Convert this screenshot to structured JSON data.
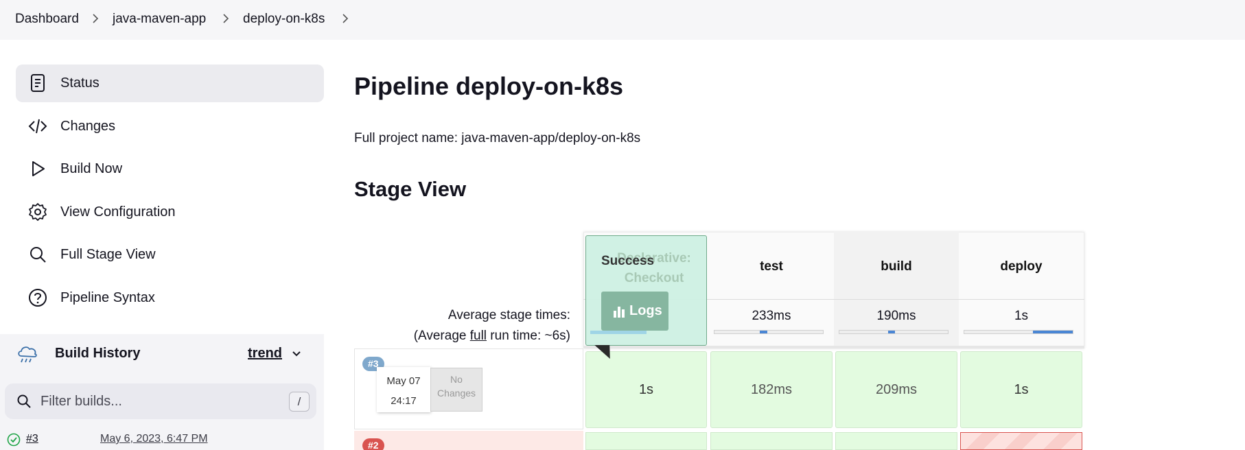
{
  "breadcrumb": {
    "items": [
      "Dashboard",
      "java-maven-app",
      "deploy-on-k8s"
    ]
  },
  "sidebar": {
    "items": [
      {
        "label": "Status",
        "icon": "document-icon"
      },
      {
        "label": "Changes",
        "icon": "code-icon"
      },
      {
        "label": "Build Now",
        "icon": "play-icon"
      },
      {
        "label": "View Configuration",
        "icon": "gear-icon"
      },
      {
        "label": "Full Stage View",
        "icon": "search-icon"
      },
      {
        "label": "Pipeline Syntax",
        "icon": "help-icon"
      }
    ],
    "build_history": {
      "title": "Build History",
      "trend_label": "trend",
      "filter_placeholder": "Filter builds...",
      "shortcut_key": "/",
      "runs": [
        {
          "number": "#3",
          "date": "May 6, 2023, 6:47 PM",
          "status": "success"
        }
      ]
    }
  },
  "main": {
    "title": "Pipeline deploy-on-k8s",
    "full_name_text": "Full project name: java-maven-app/deploy-on-k8s",
    "stage_view_title": "Stage View"
  },
  "stage_view": {
    "avg_label": "Average stage times:",
    "avg_run_prefix": "(Average ",
    "avg_run_link": "full",
    "avg_run_suffix": " run time: ~6s)",
    "stages": [
      {
        "name": "Declarative: Checkout SCM",
        "avg": "",
        "bar_fraction": 0.0
      },
      {
        "name": "test",
        "avg": "233ms",
        "bar_fraction": 0.07
      },
      {
        "name": "build",
        "avg": "190ms",
        "bar_fraction": 0.06
      },
      {
        "name": "deploy",
        "avg": "1s",
        "bar_fraction": 0.37
      }
    ],
    "runs": [
      {
        "badge": "#3",
        "date": "May 07",
        "time": "24:17",
        "changes": "No Changes",
        "durations": [
          "1s",
          "182ms",
          "209ms",
          "1s"
        ]
      },
      {
        "badge": "#2"
      }
    ],
    "tooltip": {
      "status": "Success",
      "logs_label": "Logs"
    },
    "colors": {
      "success_cell": "#e3fbe0",
      "failed_row": "#fde9e6",
      "badge_blue": "#7fa8cc",
      "badge_red": "#d9534f"
    }
  }
}
